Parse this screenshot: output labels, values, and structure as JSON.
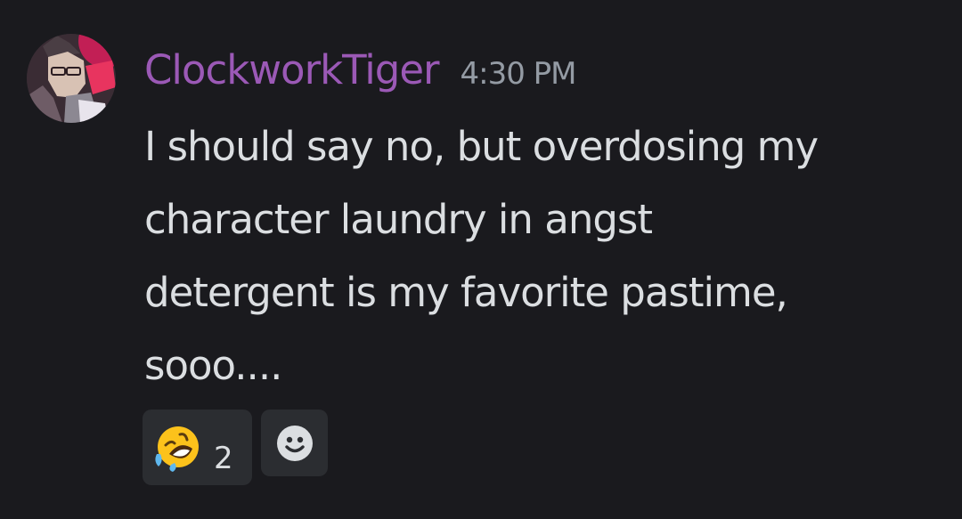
{
  "message": {
    "author": {
      "username": "ClockworkTiger",
      "username_color": "#9b59b6",
      "avatar_icon": "user-avatar"
    },
    "timestamp": "4:30 PM",
    "content_lines": [
      "I should say no, but overdosing my",
      "character laundry in angst",
      "detergent is my favorite pastime,",
      "sooo...."
    ],
    "reactions": [
      {
        "emoji_icon": "rolling-on-floor-laughing-emoji",
        "count": "2"
      }
    ],
    "add_reaction_icon": "smiley-add-reaction-icon"
  },
  "theme": {
    "background": "#1a1a1e",
    "text": "#dbdee1",
    "muted": "#949ba4",
    "chip": "#2b2d31"
  }
}
